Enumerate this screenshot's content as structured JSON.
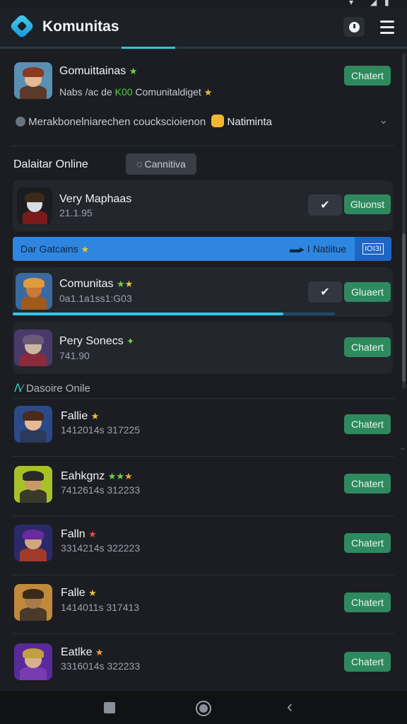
{
  "app": {
    "title": "Komunitas"
  },
  "profile": {
    "name": "Gomuittainas",
    "subtitle_prefix": "Nabs /ac de",
    "subtitle_highlight": "K00",
    "subtitle_suffix": "Comunitaldiget",
    "chat_label": "Chatert",
    "notice_text": "Merakbonelniarechen couckscioienon",
    "notice_label": "Natiminta"
  },
  "section_online": {
    "title": "Dalaitar Online",
    "filter_label": "Cannitiva"
  },
  "online_users": [
    {
      "name": "Very Maphaas",
      "sub": "21.1.95",
      "chat_label": "Gluonst",
      "check": "✔"
    },
    {
      "name": "Comunitas",
      "sub": "0a1.1a1ss1:G03",
      "chat_label": "Gluaert",
      "check": "✔"
    },
    {
      "name": "Pery Sonecs",
      "sub": "741.90",
      "chat_label": "Chatert"
    }
  ],
  "banner": {
    "left_label": "Dar Gatcains",
    "right_label": "I Natiitue",
    "badge": "IOI3I"
  },
  "progress": {
    "fraction": 0.84
  },
  "section_desaire": {
    "title": "Dasoire Onile"
  },
  "desaire_users": [
    {
      "name": "Fallie",
      "sub": "1412014s 317225",
      "chat_label": "Chatert"
    },
    {
      "name": "Eahkgnz",
      "sub": "7412614s 312233",
      "chat_label": "Chatert"
    },
    {
      "name": "Falln",
      "sub": "3314214s 322223",
      "chat_label": "Chatert"
    },
    {
      "name": "Falle",
      "sub": "1414011s 317413",
      "chat_label": "Chatert"
    },
    {
      "name": "Eatlke",
      "sub": "3316014s 322233",
      "chat_label": "Chatert"
    }
  ],
  "colors": {
    "accent": "#2fc6de",
    "chat_button": "#2e8a5e",
    "banner": "#2f86e0",
    "background": "#1b1d22"
  },
  "icons": [
    "logo-icon",
    "bell-icon",
    "menu-icon",
    "check-icon",
    "star-icon",
    "chevron-down-icon",
    "nav-square-icon",
    "nav-home-icon",
    "nav-back-icon"
  ]
}
